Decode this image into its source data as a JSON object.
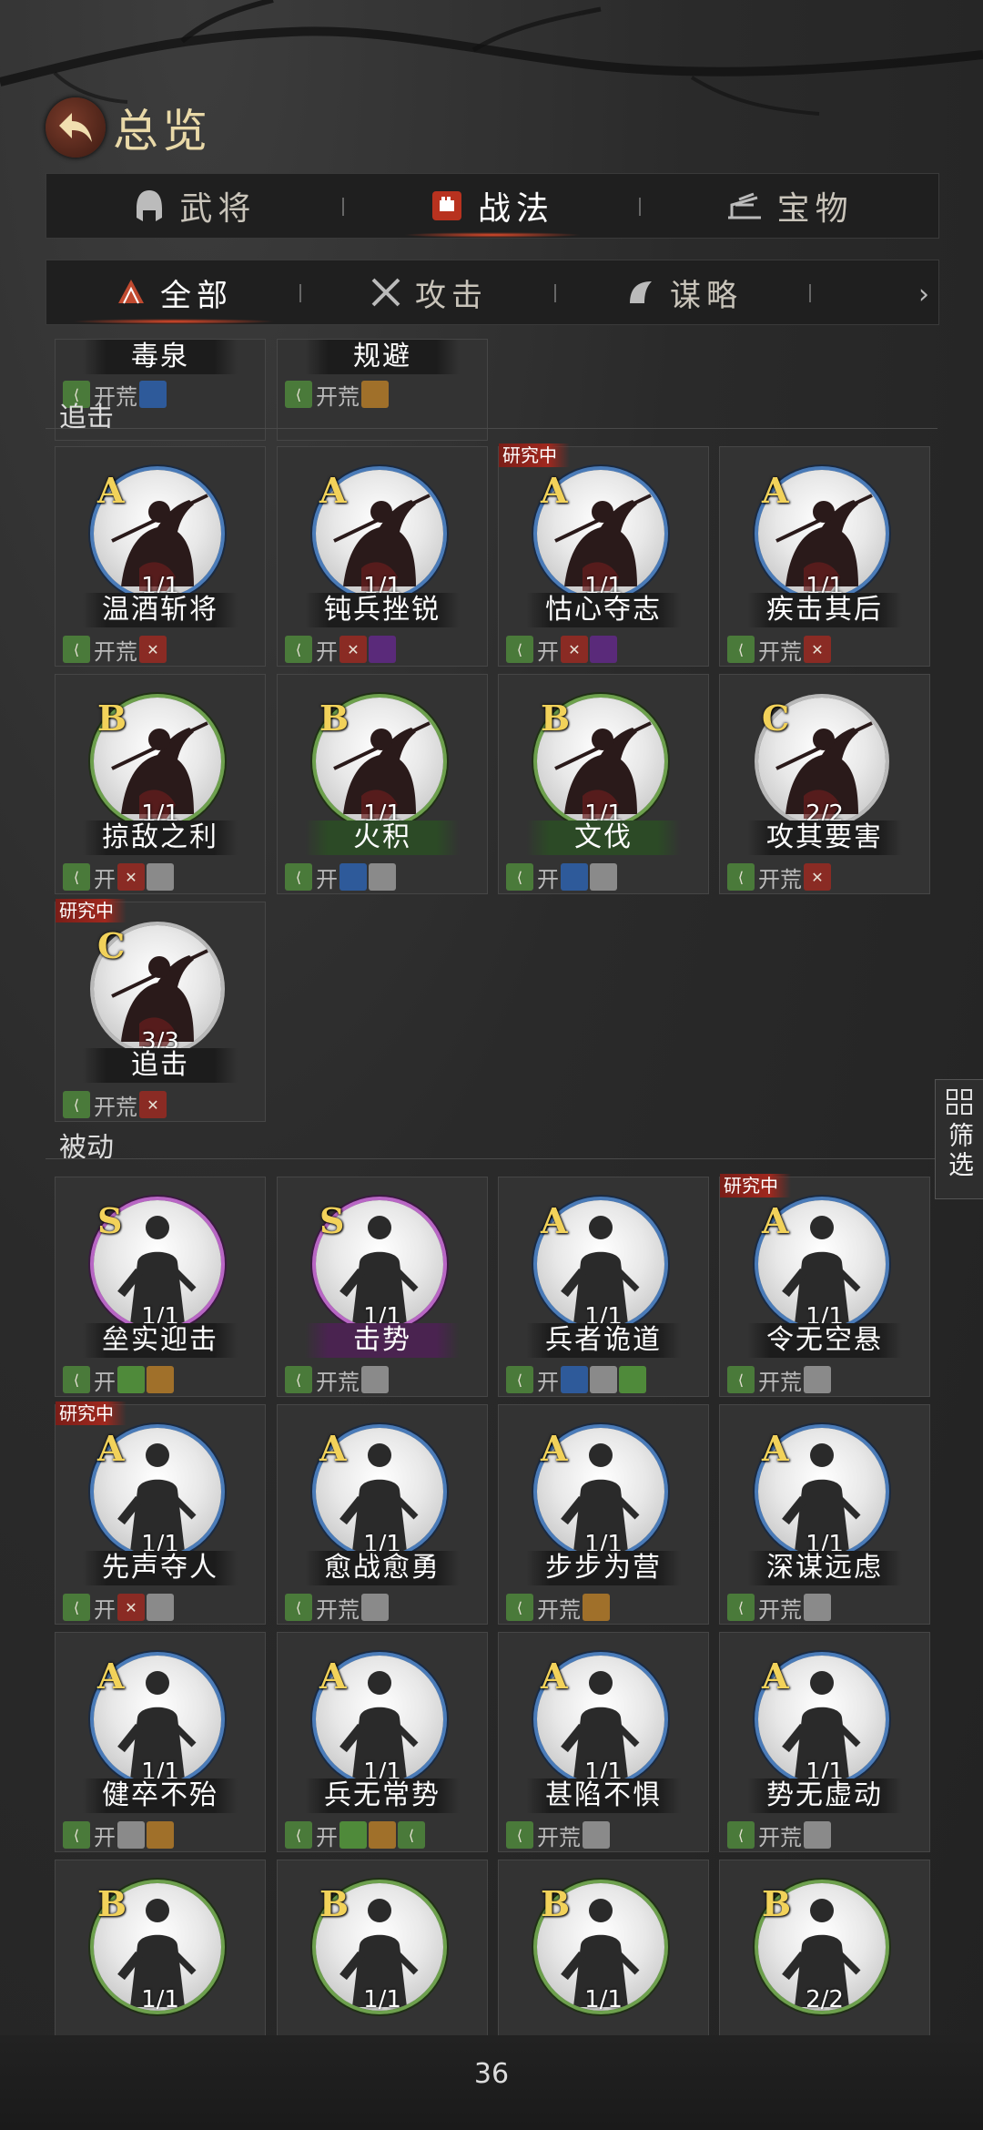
{
  "header": {
    "title": "总览"
  },
  "tabs": [
    {
      "label": "武将",
      "icon": "helmet-icon"
    },
    {
      "label": "战法",
      "icon": "fist-icon",
      "active": true
    },
    {
      "label": "宝物",
      "icon": "treasure-icon"
    }
  ],
  "subtabs": [
    {
      "label": "全部",
      "icon": "all-icon",
      "active": true
    },
    {
      "label": "攻击",
      "icon": "crossed-swords-icon"
    },
    {
      "label": "谋略",
      "icon": "strategy-icon"
    }
  ],
  "kai": "开",
  "kai_full": "开荒",
  "research_label": "研究中",
  "filter_label": "筛选",
  "page_number": "36",
  "sections": {
    "partial_top": {
      "names": [
        "毒泉",
        "规避"
      ]
    },
    "zhuiji": {
      "label": "追击",
      "cards": [
        {
          "grade": "A",
          "count": "1/1",
          "name": "温酒斩将"
        },
        {
          "grade": "A",
          "count": "1/1",
          "name": "钝兵挫锐"
        },
        {
          "grade": "A",
          "count": "1/1",
          "name": "怙心夺志",
          "research": true
        },
        {
          "grade": "A",
          "count": "1/1",
          "name": "疾击其后"
        },
        {
          "grade": "B",
          "count": "1/1",
          "name": "掠敌之利"
        },
        {
          "grade": "B",
          "count": "1/1",
          "name": "火积"
        },
        {
          "grade": "B",
          "count": "1/1",
          "name": "文伐"
        },
        {
          "grade": "C",
          "count": "2/2",
          "name": "攻其要害"
        },
        {
          "grade": "C",
          "count": "3/3",
          "name": "追击",
          "research": true
        }
      ]
    },
    "beidong": {
      "label": "被动",
      "cards": [
        {
          "grade": "S",
          "count": "1/1",
          "name": "垒实迎击"
        },
        {
          "grade": "S",
          "count": "1/1",
          "name": "击势"
        },
        {
          "grade": "A",
          "count": "1/1",
          "name": "兵者诡道"
        },
        {
          "grade": "A",
          "count": "1/1",
          "name": "令无空悬",
          "research": true
        },
        {
          "grade": "A",
          "count": "1/1",
          "name": "先声夺人",
          "research": true
        },
        {
          "grade": "A",
          "count": "1/1",
          "name": "愈战愈勇"
        },
        {
          "grade": "A",
          "count": "1/1",
          "name": "步步为营"
        },
        {
          "grade": "A",
          "count": "1/1",
          "name": "深谋远虑"
        },
        {
          "grade": "A",
          "count": "1/1",
          "name": "健卒不殆"
        },
        {
          "grade": "A",
          "count": "1/1",
          "name": "兵无常势"
        },
        {
          "grade": "A",
          "count": "1/1",
          "name": "甚陷不惧"
        },
        {
          "grade": "A",
          "count": "1/1",
          "name": "势无虚动"
        },
        {
          "grade": "B",
          "count": "1/1",
          "name": ""
        },
        {
          "grade": "B",
          "count": "1/1",
          "name": ""
        },
        {
          "grade": "B",
          "count": "1/1",
          "name": ""
        },
        {
          "grade": "B",
          "count": "2/2",
          "name": ""
        }
      ]
    }
  }
}
